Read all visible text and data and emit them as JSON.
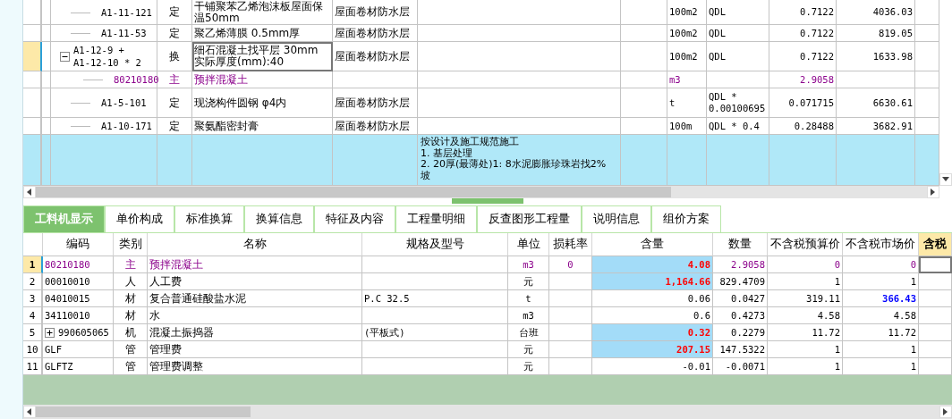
{
  "top_grid": {
    "rows": [
      {
        "kind": "quota",
        "selected": false,
        "code": "A1-11-121",
        "type": "定",
        "name": "干铺聚苯乙烯泡沫板屋面保温50mm",
        "section": "屋面卷材防水层",
        "unit": "100m2",
        "expr": "QDL",
        "qty": "0.7122",
        "price": "4036.03"
      },
      {
        "kind": "quota",
        "selected": false,
        "code": "A1-11-53",
        "type": "定",
        "name": "聚乙烯薄膜 0.5mm厚",
        "section": "屋面卷材防水层",
        "unit": "100m2",
        "expr": "QDL",
        "qty": "0.7122",
        "price": "819.05"
      },
      {
        "kind": "quota",
        "selected": true,
        "expanded": true,
        "code": "A1-12-9 + A1-12-10 * 2",
        "type": "换",
        "name": "细石混凝土找平层 30mm  实际厚度(mm):40",
        "section": "屋面卷材防水层",
        "unit": "100m2",
        "expr": "QDL",
        "qty": "0.7122",
        "price": "1633.98"
      },
      {
        "kind": "material",
        "selected": false,
        "code": "80210180",
        "type": "主",
        "name": "预拌混凝土",
        "unit": "m3",
        "qty": "2.9058"
      },
      {
        "kind": "quota",
        "selected": false,
        "code": "A1-5-101",
        "type": "定",
        "name": "现浇构件圆钢 φ4内",
        "section": "屋面卷材防水层",
        "unit": "t",
        "expr": "QDL * 0.00100695",
        "qty": "0.071715",
        "price": "6630.61"
      },
      {
        "kind": "quota",
        "selected": false,
        "code": "A1-10-171",
        "type": "定",
        "name": "聚氨酯密封膏",
        "section": "屋面卷材防水层",
        "unit": "100m",
        "expr": "QDL * 0.4",
        "qty": "0.28488",
        "price": "3682.91"
      },
      {
        "kind": "description",
        "selected": false,
        "lines": [
          "按设计及施工规范施工",
          "1. 基层处理",
          "2. 20厚(最薄处)1: 8水泥膨胀珍珠岩找2%",
          "坡"
        ]
      }
    ]
  },
  "tabs": [
    {
      "label": "工料机显示",
      "selected": true
    },
    {
      "label": "单价构成",
      "selected": false
    },
    {
      "label": "标准换算",
      "selected": false
    },
    {
      "label": "换算信息",
      "selected": false
    },
    {
      "label": "特征及内容",
      "selected": false
    },
    {
      "label": "工程量明细",
      "selected": false
    },
    {
      "label": "反查图形工程量",
      "selected": false
    },
    {
      "label": "说明信息",
      "selected": false
    },
    {
      "label": "组价方案",
      "selected": false
    }
  ],
  "bottom_grid": {
    "columns": [
      {
        "label": "编码",
        "selected": false
      },
      {
        "label": "类别",
        "selected": false
      },
      {
        "label": "名称",
        "selected": false
      },
      {
        "label": "规格及型号",
        "selected": false
      },
      {
        "label": "单位",
        "selected": false
      },
      {
        "label": "损耗率",
        "selected": false
      },
      {
        "label": "含量",
        "selected": false
      },
      {
        "label": "数量",
        "selected": false
      },
      {
        "label": "不含税预算价",
        "selected": false
      },
      {
        "label": "不含税市场价",
        "selected": false
      },
      {
        "label": "含税",
        "selected": true
      }
    ],
    "rows": [
      {
        "num": "1",
        "selected": true,
        "kind": "main",
        "code": "80210180",
        "type": "主",
        "name": "预拌混凝土",
        "unit": "m3",
        "loss": "0",
        "content": "4.08",
        "content_adjusted": true,
        "qty": "2.9058",
        "budget_price": "0",
        "market_price": "0",
        "market_adjusted": false
      },
      {
        "num": "2",
        "selected": false,
        "kind": "normal",
        "code": "00010010",
        "type": "人",
        "name": "人工费",
        "unit": "元",
        "content": "1,164.66",
        "content_adjusted": true,
        "qty": "829.4709",
        "budget_price": "1",
        "market_price": "1",
        "market_adjusted": false
      },
      {
        "num": "3",
        "selected": false,
        "kind": "normal",
        "code": "04010015",
        "type": "材",
        "name": "复合普通硅酸盐水泥",
        "spec": "P.C 32.5",
        "unit": "t",
        "content": "0.06",
        "content_adjusted": false,
        "qty": "0.0427",
        "budget_price": "319.11",
        "market_price": "366.43",
        "market_adjusted": true
      },
      {
        "num": "4",
        "selected": false,
        "kind": "normal",
        "code": "34110010",
        "type": "材",
        "name": "水",
        "unit": "m3",
        "content": "0.6",
        "content_adjusted": false,
        "qty": "0.4273",
        "budget_price": "4.58",
        "market_price": "4.58",
        "market_adjusted": false
      },
      {
        "num": "5",
        "selected": false,
        "kind": "normal",
        "expanded": false,
        "code": "990605065",
        "type": "机",
        "name": "混凝土振捣器",
        "spec": "(平板式)",
        "unit": "台班",
        "content": "0.32",
        "content_adjusted": true,
        "qty": "0.2279",
        "budget_price": "11.72",
        "market_price": "11.72",
        "market_adjusted": false
      },
      {
        "num": "10",
        "selected": false,
        "kind": "normal",
        "code": "GLF",
        "type": "管",
        "name": "管理费",
        "unit": "元",
        "content": "207.15",
        "content_adjusted": true,
        "qty": "147.5322",
        "budget_price": "1",
        "market_price": "1",
        "market_adjusted": false
      },
      {
        "num": "11",
        "selected": false,
        "kind": "normal",
        "code": "GLFTZ",
        "type": "管",
        "name": "管理费调整",
        "unit": "元",
        "content": "-0.01",
        "content_adjusted": false,
        "qty": "-0.0071",
        "budget_price": "1",
        "market_price": "1",
        "market_adjusted": false
      }
    ]
  }
}
